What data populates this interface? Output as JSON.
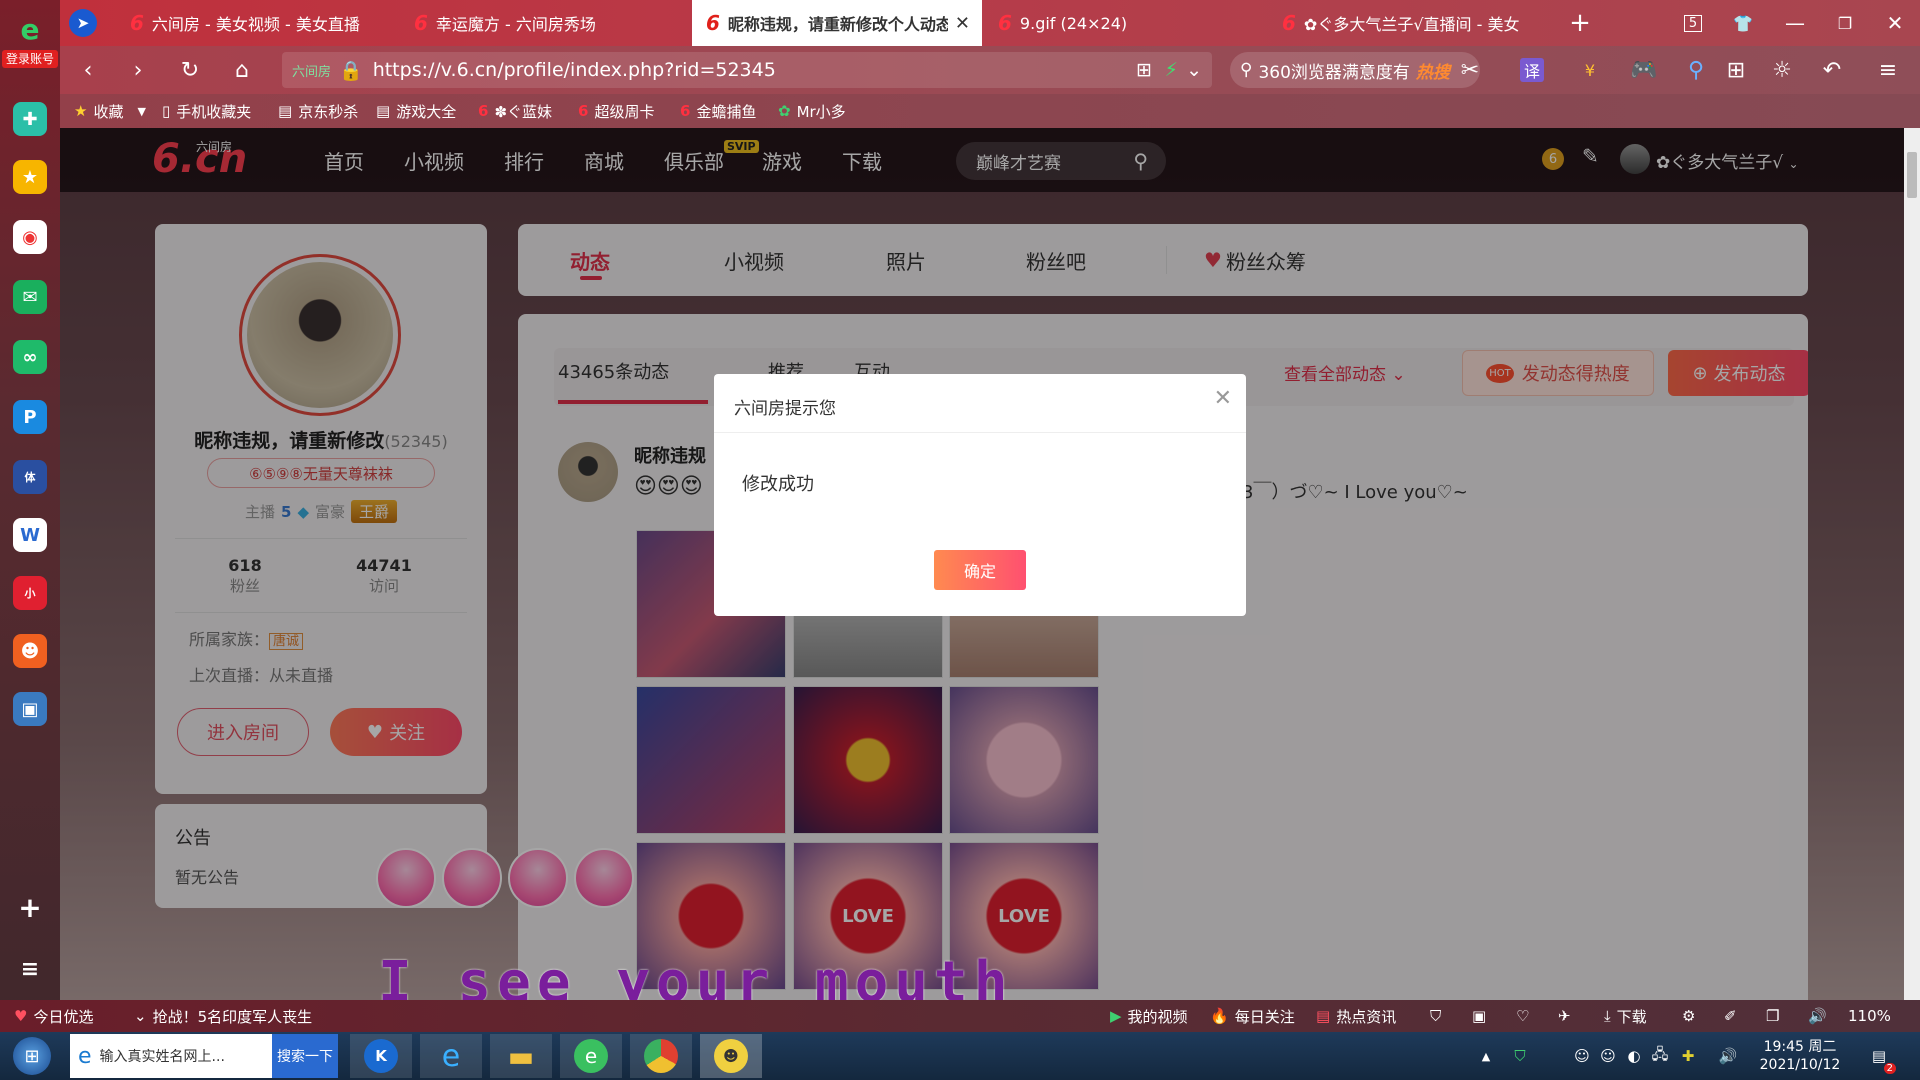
{
  "browser": {
    "tabs": [
      {
        "label": "六间房 - 美女视频 - 美女直播"
      },
      {
        "label": "幸运魔方 - 六间房秀场"
      },
      {
        "label": "昵称违规，请重新修改个人动态"
      },
      {
        "label": "9.gif (24×24)"
      },
      {
        "label": "✿ぐ多大气兰子√直播间 - 美女"
      }
    ],
    "tab_count": "5",
    "url_badge": "六间房",
    "url": "https://v.6.cn/profile/index.php?rid=52345",
    "search_placeholder": "360浏览器满意度有",
    "search_hot": "热搜",
    "translate": "译",
    "login_label": "登录账号",
    "bookmarks": [
      {
        "label": "收藏"
      },
      {
        "label": "手机收藏夹"
      },
      {
        "label": "京东秒杀"
      },
      {
        "label": "游戏大全"
      },
      {
        "label": "✽ぐ蓝妹"
      },
      {
        "label": "超级周卡"
      },
      {
        "label": "金蟾捕鱼"
      },
      {
        "label": "Mr小多"
      }
    ]
  },
  "site": {
    "logo_small": "六间房",
    "logo": "6.cn",
    "menu": [
      "首页",
      "小视频",
      "排行",
      "商城",
      "俱乐部",
      "游戏",
      "下载"
    ],
    "svip_badge": "SVIP",
    "search_value": "巅峰才艺赛",
    "user_name": "✿ぐ多大气兰子√",
    "coin": "6"
  },
  "profile": {
    "name": "昵称违规，请重新修改",
    "rid": "(52345)",
    "tag": "⑥⑤⑨⑧无量天尊袜袜",
    "anchor_label": "主播",
    "anchor_level": "5",
    "rich_label": "富豪",
    "rich_badge": "王爵",
    "fans_count": "618",
    "fans_label": "粉丝",
    "visits_count": "44741",
    "visits_label": "访问",
    "family_label": "所属家族：",
    "family_value": "唐诚",
    "last_live": "上次直播：从未直播",
    "enter_room": "进入房间",
    "follow": "关注",
    "notice_title": "公告",
    "notice_text": "暂无公告"
  },
  "content_tabs": [
    "动态",
    "小视频",
    "照片",
    "粉丝吧",
    "粉丝众筹"
  ],
  "feed": {
    "count_label": "43465条动态",
    "sub_tab_2": "推荐",
    "sub_tab_3": "互动",
    "view_all": "查看全部动态",
    "hot_btn": "发动态得热度",
    "hot_tag": "HOT",
    "publish_btn": "发布动态",
    "post_author": "昵称违规",
    "post_text": "3￣）づ♡~ I Love you♡~",
    "thumb_text_1": "LOVE",
    "thumb_text_2": "LOVE"
  },
  "modal": {
    "title": "六间房提示您",
    "message": "修改成功",
    "confirm": "确定"
  },
  "caption": "I see your mouth",
  "statusbar": {
    "left1": "今日优选",
    "left2": "抢战！5名印度军人丧生",
    "items": [
      "我的视频",
      "每日关注",
      "热点资讯",
      "下载"
    ],
    "zoom": "110%"
  },
  "taskbar": {
    "ie_item": "输入真实姓名网上...",
    "search_btn": "搜索一下",
    "time": "19:45 周二",
    "date": "2021/10/12",
    "notif_count": "2"
  }
}
